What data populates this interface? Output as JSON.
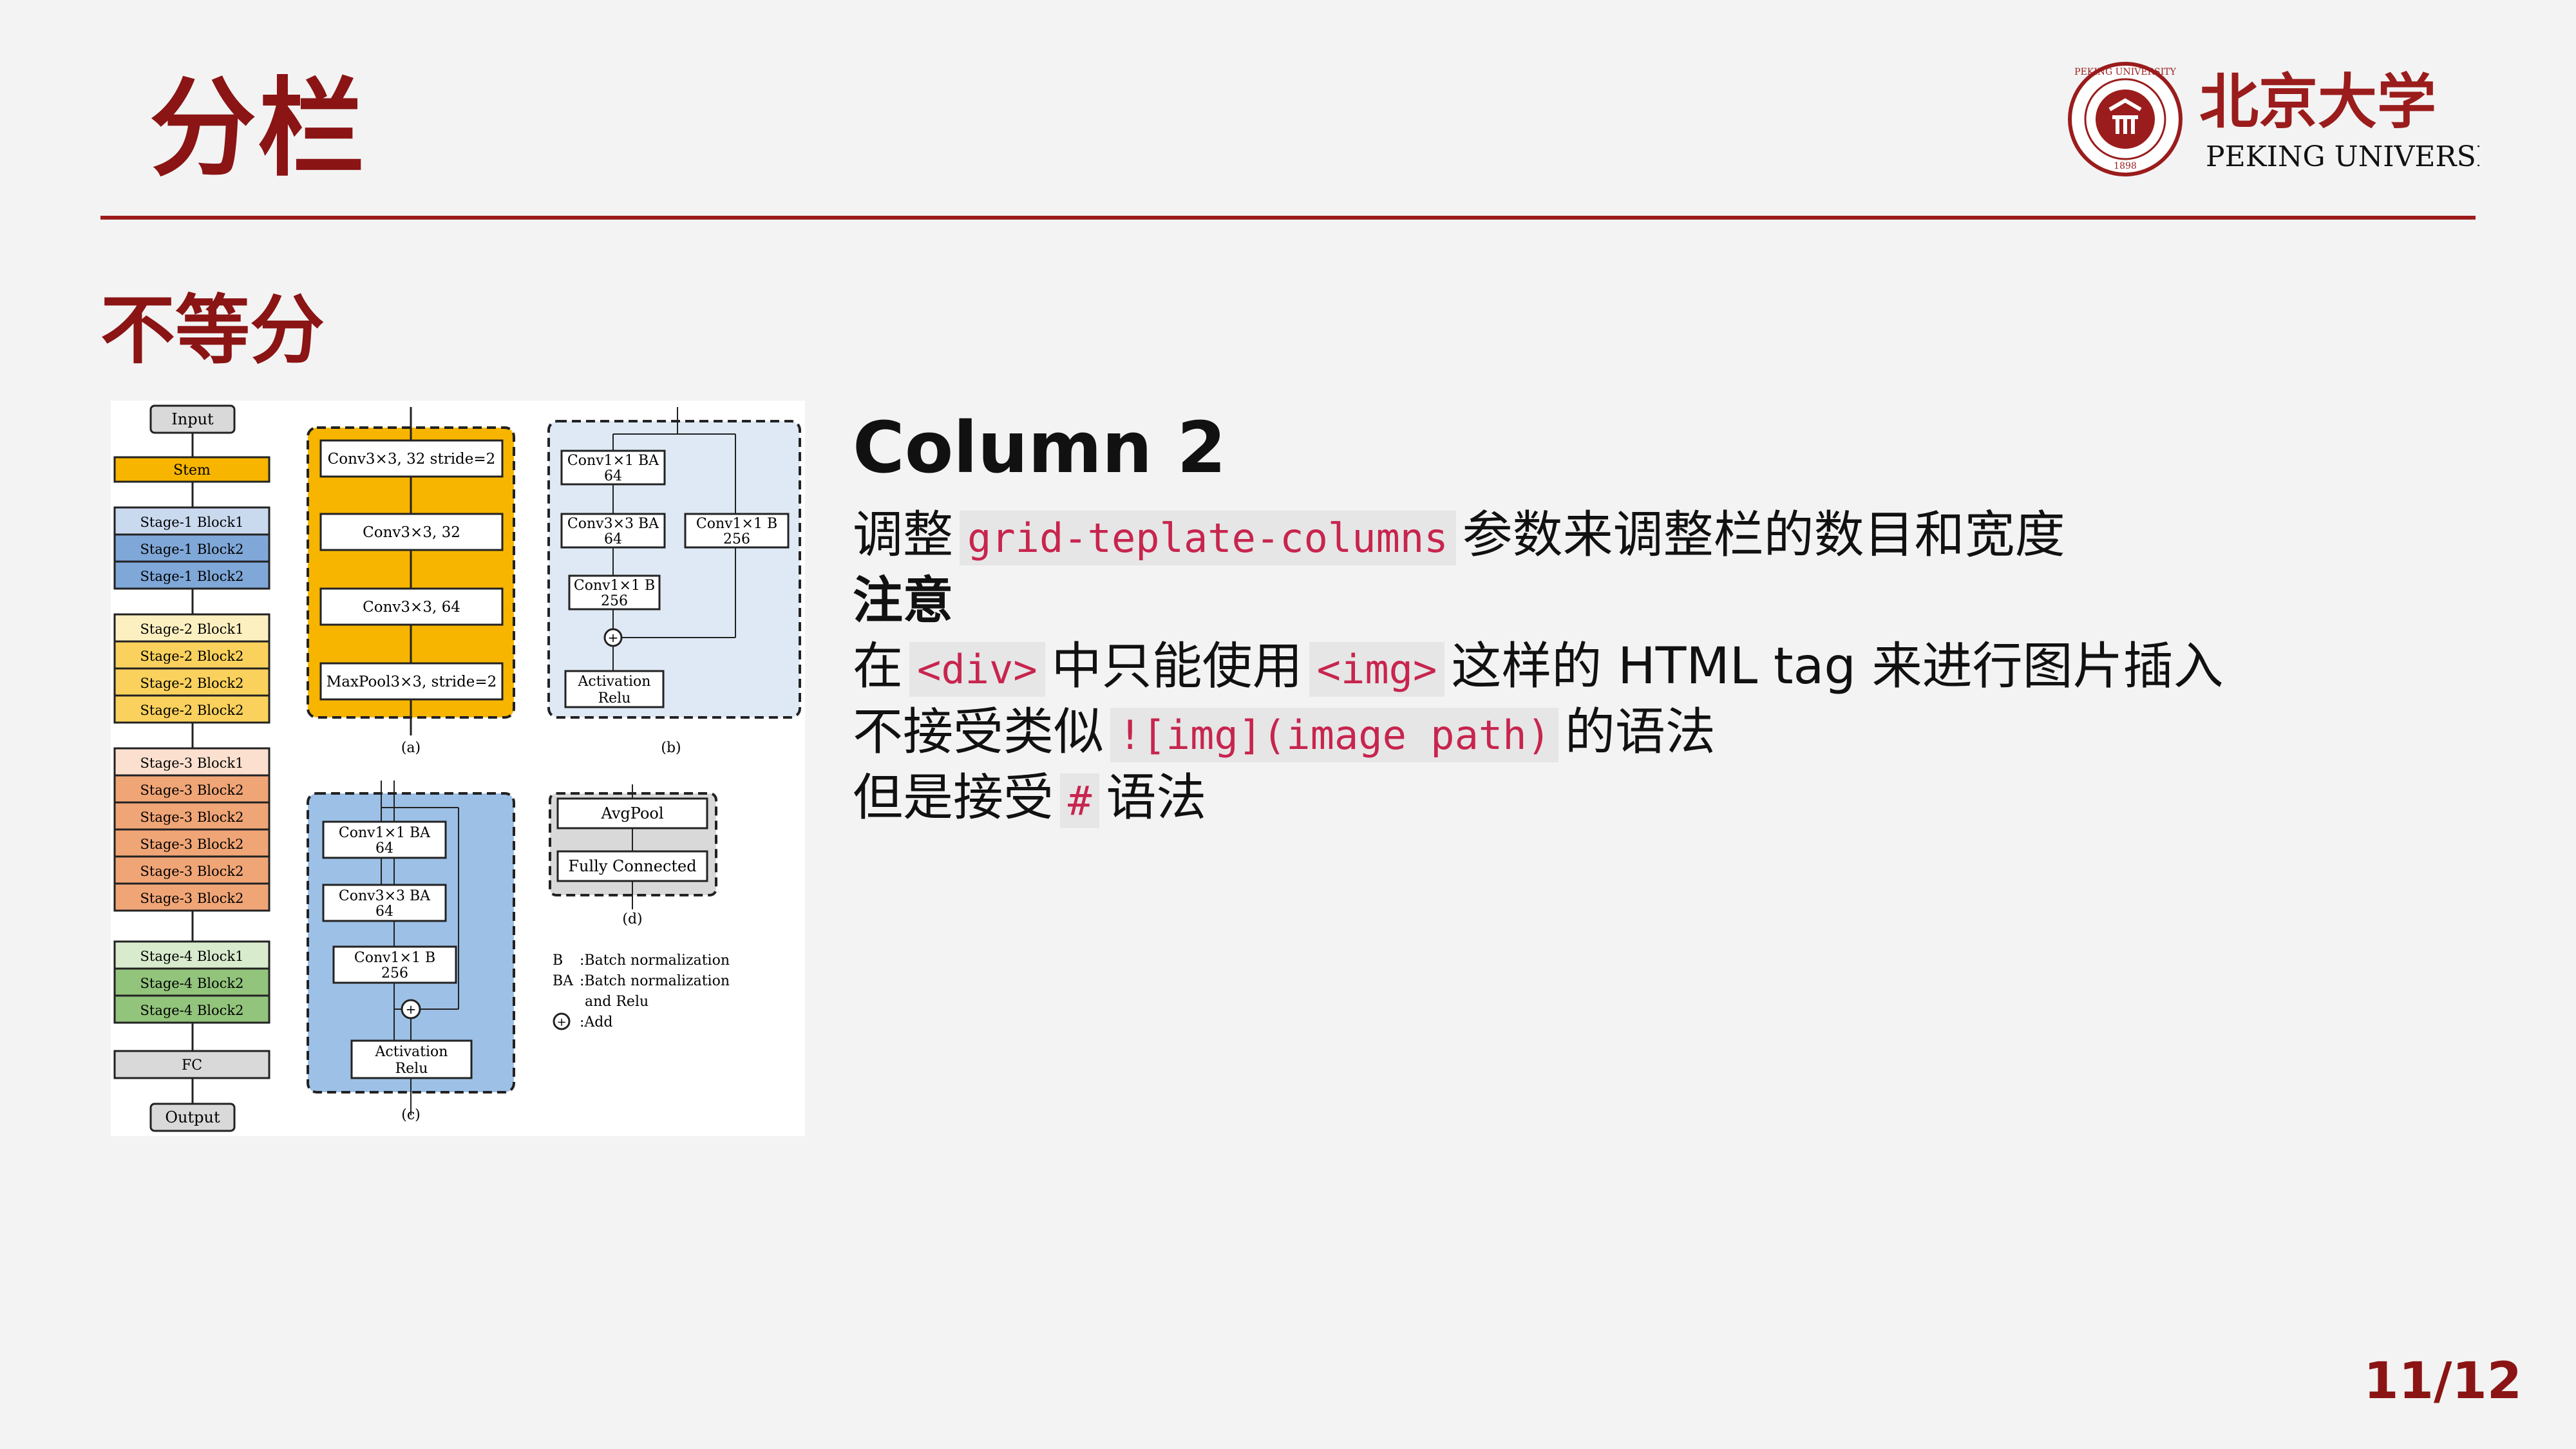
{
  "slide": {
    "title": "分栏",
    "section_title": "不等分",
    "page_number": "11/12"
  },
  "logo": {
    "chinese": "北京大学",
    "english": "PEKING UNIVERSITY",
    "seal_top": "PEKING UNIVERSITY",
    "seal_year": "1898"
  },
  "column2": {
    "heading": "Column 2",
    "line1": {
      "pre": "调整",
      "code": "grid-teplate-columns",
      "post": "参数来调整栏的数目和宽度"
    },
    "line2": {
      "text": "注意"
    },
    "line3": {
      "pre": "在",
      "code1": "<div>",
      "mid": "中只能使用",
      "code2": "<img>",
      "post": "这样的 HTML tag 来进行图片插入"
    },
    "line4": {
      "pre": "不接受类似",
      "code": "![img](image path)",
      "post": "的语法"
    },
    "line5": {
      "pre": "但是接受",
      "code": "#",
      "post": "语法"
    }
  },
  "figure": {
    "left_column": {
      "input": "Input",
      "stem": "Stem",
      "stage1": [
        "Stage-1 Block1",
        "Stage-1 Block2",
        "Stage-1 Block2"
      ],
      "stage2": [
        "Stage-2 Block1",
        "Stage-2 Block2",
        "Stage-2 Block2",
        "Stage-2 Block2"
      ],
      "stage3": [
        "Stage-3 Block1",
        "Stage-3 Block2",
        "Stage-3 Block2",
        "Stage-3 Block2",
        "Stage-3 Block2",
        "Stage-3 Block2"
      ],
      "stage4": [
        "Stage-4 Block1",
        "Stage-4 Block2",
        "Stage-4 Block2"
      ],
      "fc": "FC",
      "output": "Output"
    },
    "panel_a": {
      "boxes": [
        "Conv3×3, 32 stride=2",
        "Conv3×3, 32",
        "Conv3×3, 64",
        "MaxPool3×3, stride=2"
      ],
      "caption": "(a)"
    },
    "panel_b": {
      "box1": [
        "Conv1×1 BA",
        "64"
      ],
      "box2": [
        "Conv3×3 BA",
        "64"
      ],
      "box3": [
        "Conv1×1 B",
        "256"
      ],
      "shortcut": [
        "Conv1×1 B",
        "256"
      ],
      "add": "+",
      "activation": [
        "Activation",
        "Relu"
      ],
      "caption": "(b)"
    },
    "panel_c": {
      "box1": [
        "Conv1×1 BA",
        "64"
      ],
      "box2": [
        "Conv3×3 BA",
        "64"
      ],
      "box3": [
        "Conv1×1 B",
        "256"
      ],
      "add": "+",
      "activation": [
        "Activation",
        "Relu"
      ],
      "caption": "(c)"
    },
    "panel_d": {
      "boxes": [
        "AvgPool",
        "Fully Connected"
      ],
      "caption": "(d)"
    },
    "legend": [
      {
        "key": "B",
        "desc": ":Batch normalization"
      },
      {
        "key": "BA",
        "desc": ":Batch normalization"
      },
      {
        "key": "",
        "desc": "and Relu"
      },
      {
        "key": "+",
        "desc": ":Add"
      }
    ]
  },
  "colors": {
    "brand_red": "#8b1414",
    "stem": "#f7b500",
    "stage1": "#7fa7d8",
    "stage2": "#f9d15c",
    "stage3": "#f0a576",
    "stage4": "#92c47c",
    "panel_c_bg": "#9dc0e6",
    "panel_b_bg": "#dfe9f5"
  }
}
